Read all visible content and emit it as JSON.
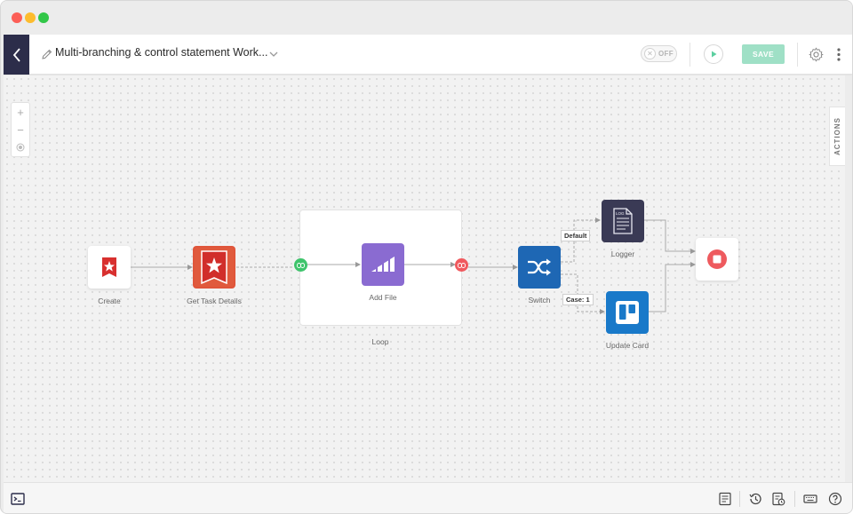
{
  "header": {
    "workflow_title": "Multi-branching & control statement Work...",
    "toggle_label": "OFF",
    "save_label": "SAVE"
  },
  "side_tab": {
    "label": "ACTIONS"
  },
  "zoom": {
    "in": "+",
    "out": "−"
  },
  "nodes": {
    "create": "Create",
    "get_task": "Get Task Details",
    "add_file": "Add File",
    "loop": "Loop",
    "switch": "Switch",
    "logger": "Logger",
    "update_card": "Update Card"
  },
  "branches": {
    "default": "Default",
    "case1": "Case: 1"
  },
  "colors": {
    "nav_dark": "#2c2d4a",
    "wunderlist_red": "#d8302f",
    "zapier_purple": "#8a6bd1",
    "switch_blue": "#1e67b4",
    "logger_dark": "#3a3a55",
    "trello_blue": "#1979c9",
    "stop_red": "#ee5a5e",
    "save_green": "#9fe0c6"
  },
  "icons": [
    "back-chevron-icon",
    "pencil-icon",
    "caret-down-icon",
    "play-icon",
    "gear-icon",
    "kebab-icon",
    "terminal-icon",
    "notes-icon",
    "history-icon",
    "log-icon",
    "keyboard-icon",
    "help-icon"
  ]
}
